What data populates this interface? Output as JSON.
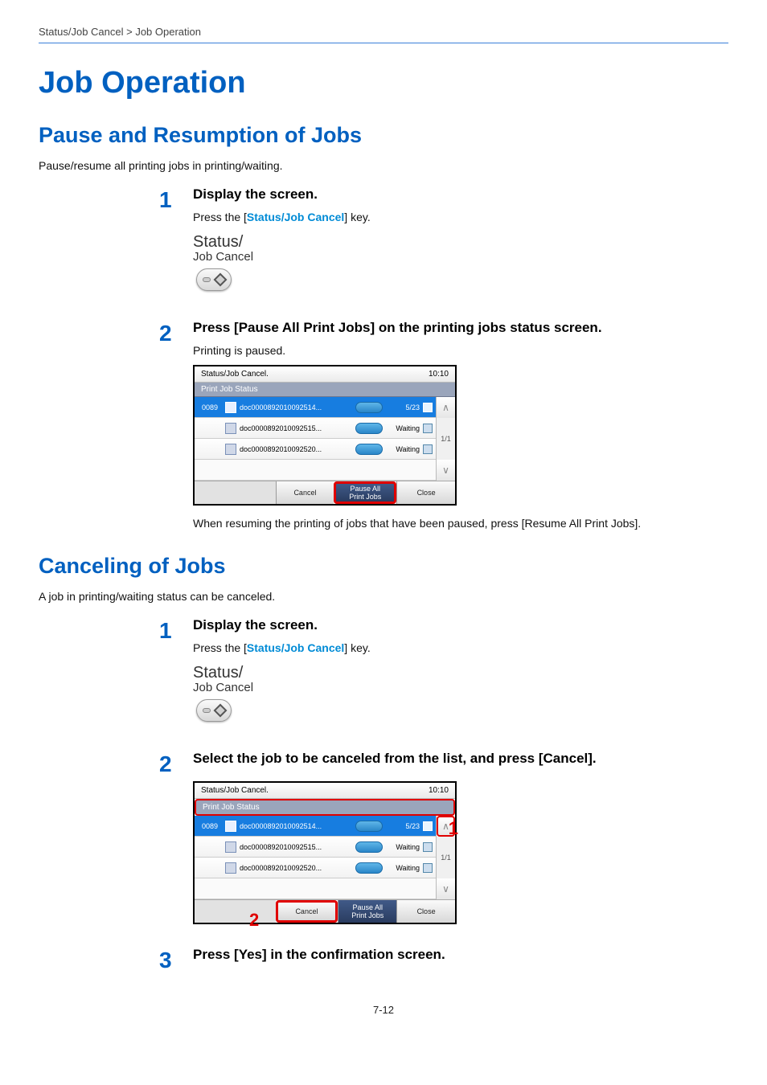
{
  "breadcrumb": "Status/Job Cancel > Job Operation",
  "h1": "Job Operation",
  "section_pause": {
    "h2": "Pause and Resumption of Jobs",
    "intro": "Pause/resume all printing jobs in printing/waiting.",
    "step1": {
      "num": "1",
      "heading": "Display the screen.",
      "text_pre": "Press the [",
      "text_link": "Status/Job Cancel",
      "text_post": "] key.",
      "key_label1": "Status/",
      "key_label2": "Job Cancel"
    },
    "step2": {
      "num": "2",
      "heading": "Press [Pause All Print Jobs] on the printing jobs status screen.",
      "sub": "Printing is paused.",
      "after": "When resuming the printing of jobs that have been paused, press [Resume All Print Jobs]."
    }
  },
  "section_cancel": {
    "h2": "Canceling of Jobs",
    "intro": "A job in printing/waiting status can be canceled.",
    "step1": {
      "num": "1",
      "heading": "Display the screen.",
      "text_pre": "Press the [",
      "text_link": "Status/Job Cancel",
      "text_post": "] key.",
      "key_label1": "Status/",
      "key_label2": "Job Cancel"
    },
    "step2": {
      "num": "2",
      "heading": "Select the job to be canceled from the list, and press [Cancel].",
      "callout1": "1",
      "callout2": "2"
    },
    "step3": {
      "num": "3",
      "heading": "Press [Yes] in the confirmation screen."
    }
  },
  "panel": {
    "title": "Status/Job Cancel.",
    "time": "10:10",
    "tab": "Print Job Status",
    "row1_num": "0089",
    "row1_name": "doc0000892010092514...",
    "row1_status": "5/23",
    "row2_name": "doc0000892010092515...",
    "row2_status": "Waiting",
    "row3_name": "doc0000892010092520...",
    "row3_status": "Waiting",
    "page": "1/1",
    "btn_cancel": "Cancel",
    "btn_pause1": "Pause All",
    "btn_pause2": "Print Jobs",
    "btn_close": "Close"
  },
  "footer": "7-12"
}
